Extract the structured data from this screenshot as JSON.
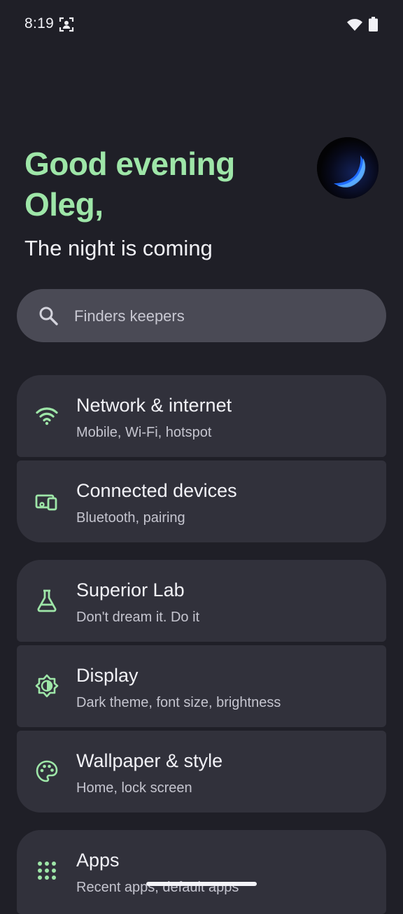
{
  "status_bar": {
    "time": "8:19",
    "icons": [
      "face-unlock-icon",
      "wifi-icon",
      "battery-icon"
    ]
  },
  "header": {
    "greeting_line1": "Good evening",
    "greeting_line2": "Oleg,",
    "subtitle": "The night is coming",
    "avatar": "planet-wallpaper-avatar"
  },
  "search": {
    "placeholder": "Finders keepers",
    "icon": "search-icon"
  },
  "colors": {
    "background": "#1f1f27",
    "accent": "#9ee6a8",
    "card": "#31313b",
    "search": "#4a4a55"
  },
  "settings": {
    "groups": [
      {
        "items": [
          {
            "title": "Network & internet",
            "subtitle": "Mobile, Wi‑Fi, hotspot",
            "icon": "wifi-icon"
          },
          {
            "title": "Connected devices",
            "subtitle": "Bluetooth, pairing",
            "icon": "devices-icon"
          }
        ]
      },
      {
        "items": [
          {
            "title": "Superior Lab",
            "subtitle": "Don't dream it. Do it",
            "icon": "flask-icon"
          },
          {
            "title": "Display",
            "subtitle": "Dark theme, font size, brightness",
            "icon": "brightness-icon"
          },
          {
            "title": "Wallpaper & style",
            "subtitle": "Home, lock screen",
            "icon": "palette-icon"
          }
        ]
      },
      {
        "items": [
          {
            "title": "Apps",
            "subtitle": "Recent apps, default apps",
            "icon": "apps-grid-icon"
          }
        ]
      }
    ]
  }
}
